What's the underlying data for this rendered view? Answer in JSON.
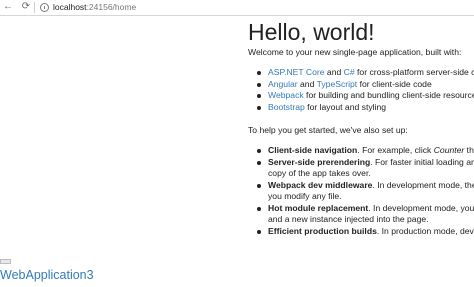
{
  "browser": {
    "url_host": "localhost",
    "url_rest": ":24156/home",
    "back_glyph": "←",
    "reload_glyph": "⟳"
  },
  "sidebar": {
    "brand": "WebApplication3"
  },
  "main": {
    "title": "Hello, world!",
    "intro": "Welcome to your new single-page application, built with:",
    "tech": {
      "aspnet": "ASP.NET Core",
      "and1": " and ",
      "csharp": "C#",
      "aspnet_rest": " for cross-platform server-side code",
      "angular": "Angular",
      "and2": " and ",
      "typescript": "TypeScript",
      "angular_rest": " for client-side code",
      "webpack": "Webpack",
      "webpack_rest": " for building and bundling client-side resources",
      "bootstrap": "Bootstrap",
      "bootstrap_rest": " for layout and styling"
    },
    "help": "To help you get started, we've also set up:",
    "features": {
      "nav_title": "Client-side navigation",
      "nav_text": ". For example, click ",
      "nav_counter": "Counter",
      "nav_text2": " then",
      "prerender_title": "Server-side prerendering",
      "prerender_text": ". For faster initial loading and",
      "prerender_text2": "copy of the app takes over.",
      "webpack_title": "Webpack dev middleware",
      "webpack_text": ". In development mode, there",
      "webpack_text2": "you modify any file.",
      "hmr_title": "Hot module replacement",
      "hmr_text": ". In development mode, you c",
      "hmr_text2": "and a new instance injected into the page.",
      "prod_title": "Efficient production builds",
      "prod_text": ". In production mode, develo"
    }
  },
  "colors": {
    "link": "#337ab7",
    "text": "#222222"
  }
}
